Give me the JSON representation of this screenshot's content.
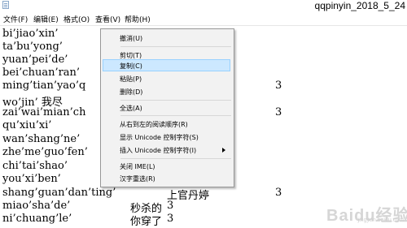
{
  "window": {
    "title": "qqpinyin_2018_5_24"
  },
  "menubar": {
    "items": [
      {
        "label": "文件(F)"
      },
      {
        "label": "编辑(E)"
      },
      {
        "label": "格式(O)"
      },
      {
        "label": "查看(V)"
      },
      {
        "label": "帮助(H)"
      }
    ]
  },
  "editor": {
    "rows": [
      {
        "c1": "bi’jiao’xin’",
        "c2": "",
        "c3": "",
        "c4": ""
      },
      {
        "c1": "ta’bu’yong’",
        "c2": "",
        "c3": "",
        "c4": ""
      },
      {
        "c1": "yuan’pei’de’",
        "c2": "",
        "c3": "",
        "c4": ""
      },
      {
        "c1": "bei’chuan’ran’",
        "c2": "",
        "c3": "",
        "c4": ""
      },
      {
        "c1": "ming’tian’yao’q",
        "c2": "",
        "c3": "",
        "c4": "3"
      },
      {
        "c1": "wo’jin’  我尽",
        "c2": "",
        "c3": "",
        "c4": ""
      },
      {
        "c1": "zai’wai’mian’ch",
        "c2": "",
        "c3": "",
        "c4": "3"
      },
      {
        "c1": "qu’xiu’xi’",
        "c2": "",
        "c3": "",
        "c4": ""
      },
      {
        "c1": "wan’shang’ne’",
        "c2": "",
        "c3": "",
        "c4": ""
      },
      {
        "c1": "zhe’me’guo’fen’",
        "c2": "",
        "c3": "",
        "c4": ""
      },
      {
        "c1": "chi’tai’shao’",
        "c2": "",
        "c3": "",
        "c4": ""
      },
      {
        "c1": "you’xi’ben’",
        "c2": "",
        "c3": "",
        "c4": ""
      },
      {
        "c1": "shang’guan’dan’ting’",
        "c2": "",
        "c3": "上官丹婷",
        "c4": "3"
      },
      {
        "c1": "miao’sha’de’",
        "c2": "秒杀的",
        "c3": "3",
        "c4": ""
      },
      {
        "c1": "ni’chuang’le’",
        "c2": "你穿了",
        "c3": "3",
        "c4": ""
      }
    ]
  },
  "context_menu": {
    "items": [
      {
        "label": "撤消(U)"
      },
      {
        "label": "剪切(T)"
      },
      {
        "label": "复制(C)"
      },
      {
        "label": "粘贴(P)"
      },
      {
        "label": "删除(D)"
      },
      {
        "label": "全选(A)"
      },
      {
        "label": "从右到左的阅读顺序(R)"
      },
      {
        "label": "显示 Unicode 控制字符(S)"
      },
      {
        "label": "插入 Unicode 控制字符(I)"
      },
      {
        "label": "关闭 IME(L)"
      },
      {
        "label": "汉字重选(R)"
      }
    ],
    "highlighted_item": "复制(C)"
  },
  "watermark": {
    "text": "Baidu经验",
    "sub": "jingyan.baidu.com"
  },
  "colors": {
    "selection": "#3399ff",
    "menu_highlight": "#cce8ff"
  }
}
